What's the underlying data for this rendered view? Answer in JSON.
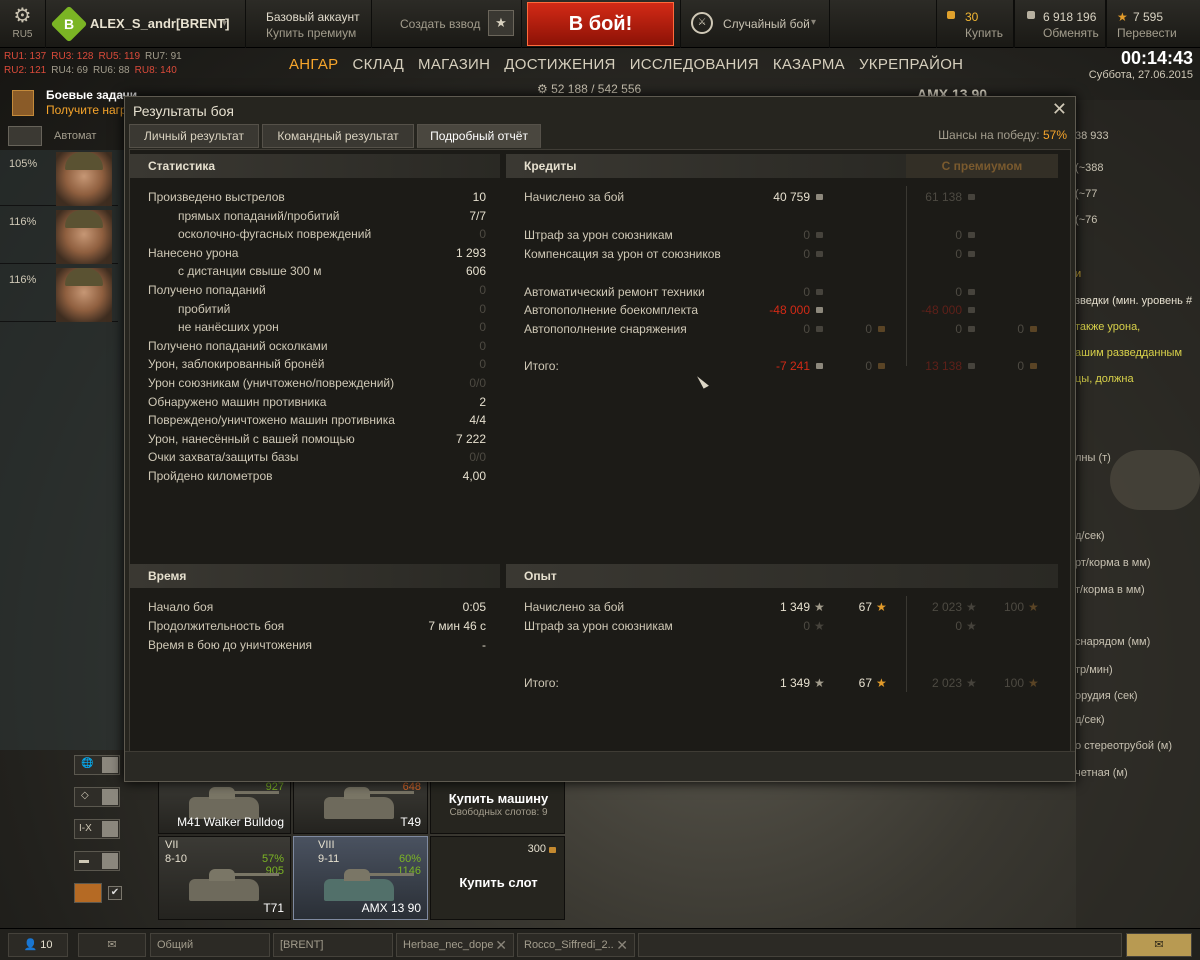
{
  "topbar": {
    "server": "RU5",
    "clan_tag": "B",
    "player_name": "ALEX_S_andr[BRENT]",
    "account_type": "Базовый аккаунт",
    "buy_premium": "Купить премиум",
    "create_platoon": "Создать взвод",
    "fight_button": "В бой!",
    "battle_mode": "Случайный бой",
    "gold_value": "30",
    "gold_action": "Купить",
    "credits_value": "6 918 196",
    "credits_action": "Обменять",
    "xp_value": "7 595",
    "xp_action": "Перевести"
  },
  "server_ranks": [
    {
      "label": "RU1: 137",
      "color": "#d94a3a"
    },
    {
      "label": "RU3: 128",
      "color": "#d94a3a"
    },
    {
      "label": "RU5: 119",
      "color": "#d94a3a"
    },
    {
      "label": "RU7: 91",
      "color": "#a39d8d"
    },
    {
      "label": "RU2: 121",
      "color": "#d94a3a"
    },
    {
      "label": "RU4: 69",
      "color": "#a39d8d"
    },
    {
      "label": "RU6: 88",
      "color": "#a39d8d"
    },
    {
      "label": "RU8: 140",
      "color": "#d94a3a"
    }
  ],
  "nav": [
    "АНГАР",
    "СКЛАД",
    "МАГАЗИН",
    "ДОСТИЖЕНИЯ",
    "ИССЛЕДОВАНИЯ",
    "КАЗАРМА",
    "УКРЕПРАЙОН"
  ],
  "clock": {
    "time": "00:14:43",
    "date": "Суббота, 27.06.2015"
  },
  "tank_xp": "52 188 / 542 556",
  "tank_title": "AMX 13 90",
  "tasks": {
    "title": "Боевые задачи",
    "subtitle": "Получите награ"
  },
  "auto_label": "Автомат",
  "crew": [
    {
      "pct": "105%"
    },
    {
      "pct": "116%"
    },
    {
      "pct": "116%"
    }
  ],
  "filters": {
    "tier": "I-X"
  },
  "carousel": {
    "m41": {
      "name": "M41 Walker Bulldog",
      "xp": "927"
    },
    "t49": {
      "name": "T49",
      "xp": "648"
    },
    "t71": {
      "name": "T71",
      "tier": "VII",
      "battles": "8-10",
      "winrate": "57%",
      "xp": "905"
    },
    "amx": {
      "name": "AMX 13 90",
      "tier": "VIII",
      "battles": "9-11",
      "winrate": "60%",
      "xp": "1146"
    },
    "buy_vehicle": "Купить машину",
    "free_slots": "Свободных слотов: 9",
    "buy_slot": "Купить слот",
    "slot_price": "300"
  },
  "right_bg": [
    "38 933",
    "(~388",
    "(~77",
    "(~76",
    "и",
    "зведки (мин. уровень #",
    "также урона,",
    "ашим разведданным",
    "цы, должна",
    "лны (т)",
    "д/сек)",
    "рт/корма в мм)",
    "т/корма в мм)",
    "снарядом (мм)",
    "тр/мин)",
    "орудия (сек)",
    "д/сек)",
    "о стереотрубой (м)",
    "четная (м)"
  ],
  "chat": {
    "players_online": "10",
    "tab_general": "Общий",
    "tab_clan": "[BRENT]",
    "tab_user1": "Herbae_nec_dope",
    "tab_user2": "Rocco_Siffredi_2.."
  },
  "dialog": {
    "title": "Результаты боя",
    "tabs": [
      "Личный результат",
      "Командный результат",
      "Подробный отчёт"
    ],
    "win_chance_label": "Шансы на победу:",
    "win_chance_value": "57%",
    "statistics": {
      "header": "Статистика",
      "rows": [
        {
          "label": "Произведено выстрелов",
          "value": "10",
          "sub": false,
          "dim": false
        },
        {
          "label": "прямых попаданий/пробитий",
          "value": "7/7",
          "sub": true,
          "dim": false
        },
        {
          "label": "осколочно-фугасных повреждений",
          "value": "0",
          "sub": true,
          "dim": true
        },
        {
          "label": "Нанесено урона",
          "value": "1 293",
          "sub": false,
          "dim": false
        },
        {
          "label": "с дистанции свыше 300 м",
          "value": "606",
          "sub": true,
          "dim": false
        },
        {
          "label": "Получено попаданий",
          "value": "0",
          "sub": false,
          "dim": true
        },
        {
          "label": "пробитий",
          "value": "0",
          "sub": true,
          "dim": true
        },
        {
          "label": "не нанёсших урон",
          "value": "0",
          "sub": true,
          "dim": true
        },
        {
          "label": "Получено попаданий осколками",
          "value": "0",
          "sub": false,
          "dim": true
        },
        {
          "label": "Урон, заблокированный бронёй",
          "value": "0",
          "sub": false,
          "dim": true
        },
        {
          "label": "Урон союзникам (уничтожено/повреждений)",
          "value": "0/0",
          "sub": false,
          "dim": true
        },
        {
          "label": "Обнаружено машин противника",
          "value": "2",
          "sub": false,
          "dim": false
        },
        {
          "label": "Повреждено/уничтожено машин противника",
          "value": "4/4",
          "sub": false,
          "dim": false
        },
        {
          "label": "Урон, нанесённый с вашей помощью",
          "value": "7 222",
          "sub": false,
          "dim": false
        },
        {
          "label": "Очки захвата/защиты базы",
          "value": "0/0",
          "sub": false,
          "dim": true
        },
        {
          "label": "Пройдено километров",
          "value": "4,00",
          "sub": false,
          "dim": false
        }
      ]
    },
    "credits": {
      "header": "Кредиты",
      "premium_header": "С премиумом",
      "earned": {
        "label": "Начислено за бой",
        "value": "40 759",
        "premium": "61 138"
      },
      "ally_penalty": {
        "label": "Штраф за урон союзникам",
        "value": "0",
        "premium": "0"
      },
      "ally_compensation": {
        "label": "Компенсация за урон от союзников",
        "value": "0",
        "premium": "0"
      },
      "auto_repair": {
        "label": "Автоматический ремонт техники",
        "value": "0",
        "premium": "0"
      },
      "auto_ammo": {
        "label": "Автопополнение боекомплекта",
        "value": "-48 000",
        "premium": "-48 000"
      },
      "auto_equip": {
        "label": "Автопополнение снаряжения",
        "value": "0",
        "gold": "0",
        "premium": "0",
        "premium_gold": "0"
      },
      "total": {
        "label": "Итого:",
        "value": "-7 241",
        "gold": "0",
        "premium": "13 138",
        "premium_gold": "0"
      }
    },
    "time": {
      "header": "Время",
      "rows": [
        {
          "label": "Начало боя",
          "value": "0:05"
        },
        {
          "label": "Продолжительность боя",
          "value": "7 мин 46 с"
        },
        {
          "label": "Время в бою до уничтожения",
          "value": "-"
        }
      ]
    },
    "experience": {
      "header": "Опыт",
      "earned": {
        "label": "Начислено за бой",
        "value": "1 349",
        "free": "67",
        "premium": "2 023",
        "premium_free": "100"
      },
      "ally_penalty": {
        "label": "Штраф за урон союзникам",
        "value": "0",
        "premium": "0"
      },
      "total": {
        "label": "Итого:",
        "value": "1 349",
        "free": "67",
        "premium": "2 023",
        "premium_free": "100"
      }
    }
  }
}
